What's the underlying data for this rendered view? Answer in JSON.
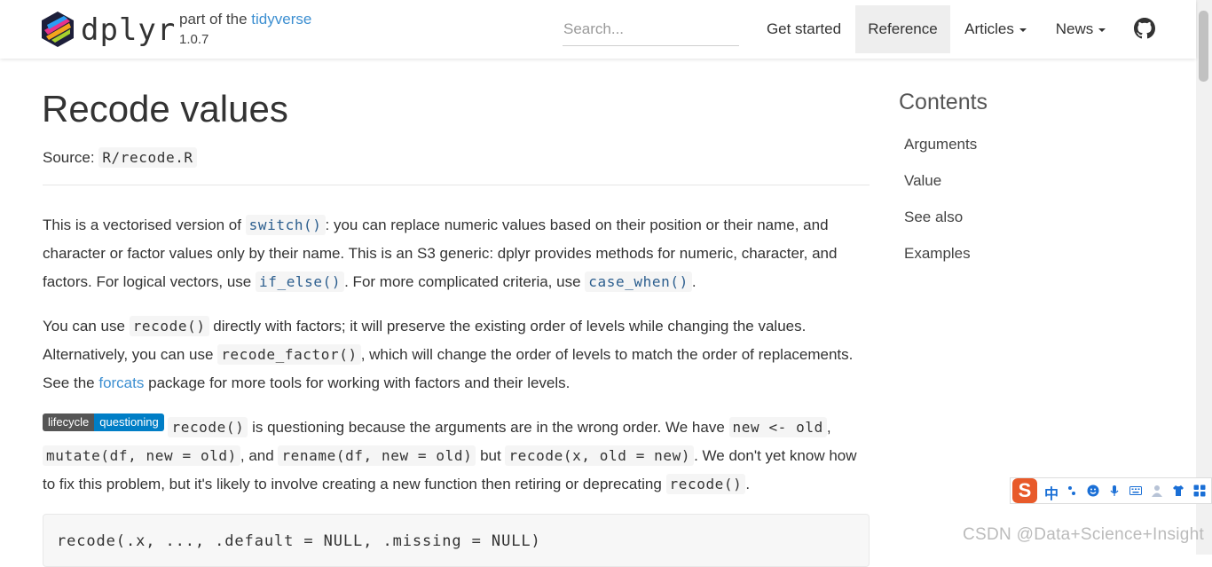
{
  "navbar": {
    "brand": "dplyr",
    "part_of_prefix": "part of the ",
    "part_of_link": "tidyverse",
    "version": "1.0.7",
    "search_placeholder": "Search...",
    "links": [
      {
        "label": "Get started",
        "active": false
      },
      {
        "label": "Reference",
        "active": true
      },
      {
        "label": "Articles",
        "active": false
      },
      {
        "label": "News",
        "active": false
      }
    ],
    "github_icon": "github-icon"
  },
  "page": {
    "title": "Recode values",
    "source_label": "Source:",
    "source_file": "R/recode.R"
  },
  "p1": {
    "t1": "This is a vectorised version of",
    "c1": "switch()",
    "t2": ": you can replace numeric values based on their position or their name, and character or factor values only by their name. This is an S3 generic: dplyr provides methods for numeric, character, and factors. For logical vectors, use",
    "c2": "if_else()",
    "t3": ". For more complicated criteria, use",
    "c3": "case_when()",
    "t4": "."
  },
  "p2": {
    "t1": "You can use",
    "c1": "recode()",
    "t2": "directly with factors; it will preserve the existing order of levels while changing the values. Alternatively, you can use",
    "c2": "recode_factor()",
    "t3": ", which will change the order of levels to match the order of replacements. See the",
    "link": "forcats",
    "t4": "package for more tools for working with factors and their levels."
  },
  "p3": {
    "badge_left": "lifecycle",
    "badge_right": "questioning",
    "c1": "recode()",
    "t1": "is questioning because the arguments are in the wrong order. We have",
    "c2": "new <- old",
    "t2": ",",
    "c3": "mutate(df, new = old)",
    "t3": ", and",
    "c4": "rename(df, new = old)",
    "t4": "but",
    "c5": "recode(x, old = new)",
    "t5": ". We don't yet know how to fix this problem, but it's likely to involve creating a new function then retiring or deprecating",
    "c6": "recode()",
    "t6": "."
  },
  "usage": "recode(.x, ..., .default = NULL, .missing = NULL)",
  "toc": {
    "title": "Contents",
    "items": [
      "Arguments",
      "Value",
      "See also",
      "Examples"
    ]
  },
  "ime": {
    "logo": "S",
    "mode": "中",
    "icons": [
      "punctuation-icon",
      "emoji-icon",
      "microphone-icon",
      "keyboard-icon",
      "user-icon",
      "shirt-icon",
      "grid-icon"
    ]
  },
  "watermark": "CSDN @Data+Science+Insight",
  "colors": {
    "link": "#3d8fd1",
    "active_nav_bg": "#eeeeee",
    "badge_left": "#555555",
    "badge_right": "#007ec6",
    "ime_logo": "#e85a2a"
  }
}
